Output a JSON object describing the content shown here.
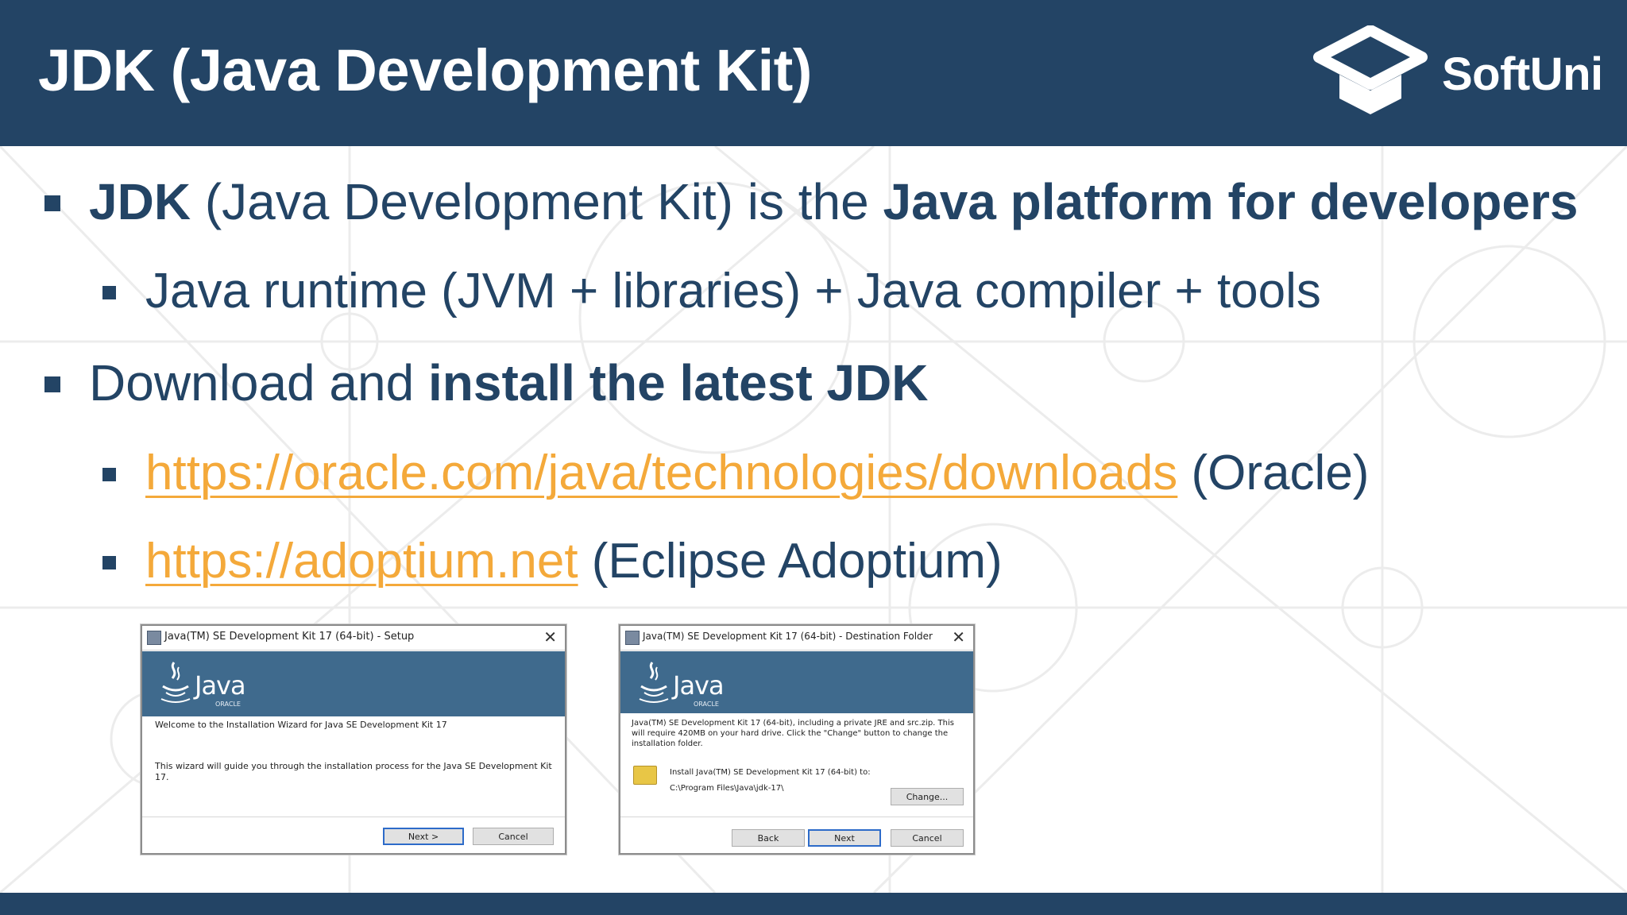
{
  "slide": {
    "title": "JDK (Java Development Kit)",
    "logo_text": "SoftUni"
  },
  "bullets": {
    "b1": {
      "bold1": "JDK",
      "text1": " (Java Development Kit) is the ",
      "bold2": "Java platform for developers"
    },
    "b1_1": {
      "text": "Java runtime (JVM + libraries) + Java compiler + tools"
    },
    "b2": {
      "text1": "Download and ",
      "bold1": "install the latest JDK"
    },
    "b2_1": {
      "link": "https://oracle.com/java/technologies/downloads",
      "suffix": " (Oracle)"
    },
    "b2_2": {
      "link": "https://adoptium.net",
      "suffix": " (Eclipse Adoptium)"
    }
  },
  "dialog_setup": {
    "title": "Java(TM) SE Development Kit 17 (64-bit) - Setup",
    "close": "✕",
    "java_word": "Java",
    "oracle_word": "ORACLE",
    "welcome": "Welcome to the Installation Wizard for Java SE Development Kit 17",
    "guide": "This wizard will guide you through the installation process for the Java SE Development Kit 17.",
    "next_label": "Next >",
    "cancel_label": "Cancel"
  },
  "dialog_dest": {
    "title": "Java(TM) SE Development Kit 17 (64-bit) - Destination Folder",
    "close": "✕",
    "java_word": "Java",
    "oracle_word": "ORACLE",
    "desc": "Java(TM) SE Development Kit 17 (64-bit), including a private JRE and src.zip.  This will require 420MB on your hard drive. Click the \"Change\" button to change the installation folder.",
    "install_label": "Install Java(TM) SE Development Kit 17 (64-bit) to:",
    "install_path": "C:\\Program Files\\Java\\jdk-17\\",
    "change_label": "Change...",
    "back_label": "Back",
    "next_label": "Next",
    "cancel_label": "Cancel"
  },
  "colors": {
    "header_bg": "#234465",
    "text": "#234465",
    "link": "#f4a93a",
    "java_banner": "#3f6a8d"
  },
  "icons": [
    "softuni-logo-icon",
    "java-cup-icon",
    "setup-app-icon",
    "folder-icon",
    "close-icon"
  ]
}
